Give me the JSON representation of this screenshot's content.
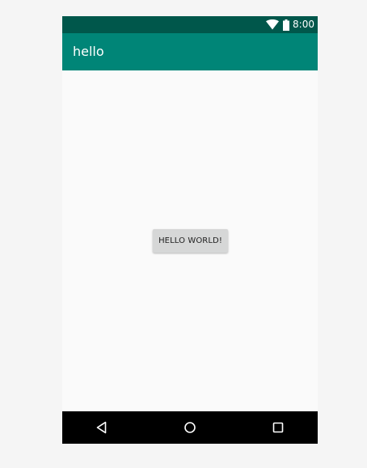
{
  "status_bar": {
    "time": "8:00",
    "wifi_icon": "wifi-icon",
    "battery_icon": "battery-icon"
  },
  "app_bar": {
    "title": "hello",
    "color": "#008577"
  },
  "main": {
    "button_label": "HELLO WORLD!"
  },
  "nav_bar": {
    "back_icon": "back-triangle-icon",
    "home_icon": "home-circle-icon",
    "recents_icon": "recents-square-icon"
  },
  "colors": {
    "status_bar": "#00574b",
    "app_bar": "#008577",
    "content_background": "#fafafa",
    "button": "#d6d7d7",
    "nav_bar": "#000000"
  }
}
